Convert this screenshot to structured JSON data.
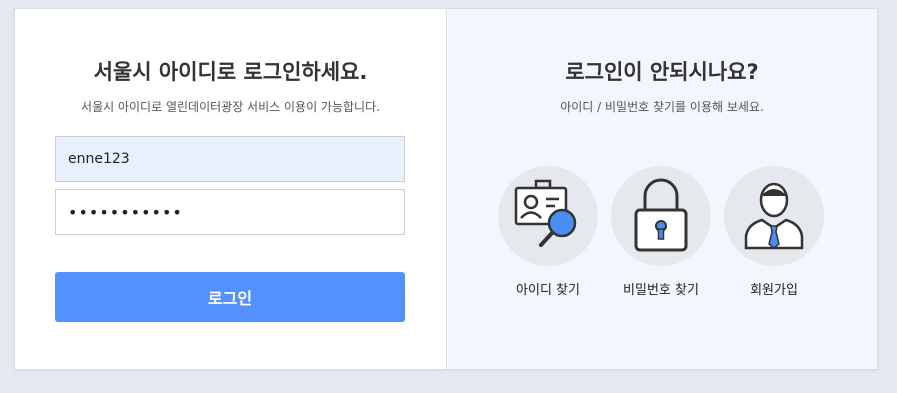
{
  "login": {
    "title": "서울시 아이디로 로그인하세요.",
    "subtitle": "서울시 아이디로 열린데이터광장 서비스 이용이 가능합니다.",
    "id_value": "enne123",
    "password_value": "•••••••••••",
    "button_label": "로그인"
  },
  "help": {
    "title": "로그인이 안되시나요?",
    "subtitle": "아이디 / 비밀번호 찾기를 이용해 보세요.",
    "items": [
      {
        "label": "아이디 찾기",
        "icon": "id-card-search-icon"
      },
      {
        "label": "비밀번호 찾기",
        "icon": "padlock-icon"
      },
      {
        "label": "회원가입",
        "icon": "user-person-icon"
      }
    ]
  },
  "colors": {
    "accent": "#5590ff",
    "background": "#e4e9f2",
    "help_panel": "#f3f6fc",
    "icon_blue": "#4a8df5"
  }
}
